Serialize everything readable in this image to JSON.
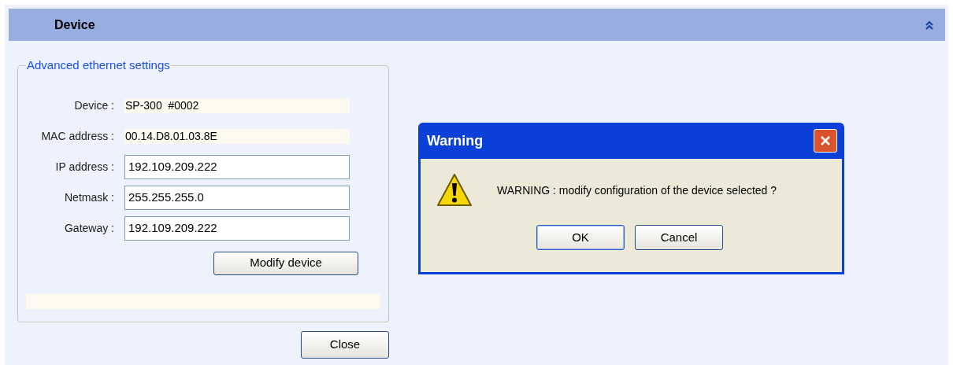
{
  "panel": {
    "title": "Device"
  },
  "group": {
    "legend": "Advanced ethernet settings",
    "fields": [
      {
        "label": "Device :",
        "value": "SP-300  #0002",
        "kind": "readonly"
      },
      {
        "label": "MAC address :",
        "value": "00.14.D8.01.03.8E",
        "kind": "readonly"
      },
      {
        "label": "IP address :",
        "value": "192.109.209.222",
        "kind": "input"
      },
      {
        "label": "Netmask :",
        "value": "255.255.255.0",
        "kind": "input"
      },
      {
        "label": "Gateway :",
        "value": "192.109.209.222",
        "kind": "input"
      }
    ],
    "button": "Modify device"
  },
  "close_button": "Close",
  "dialog": {
    "title": "Warning",
    "message": "WARNING : modify configuration of the device selected ?",
    "buttons": [
      "OK",
      "Cancel"
    ]
  }
}
